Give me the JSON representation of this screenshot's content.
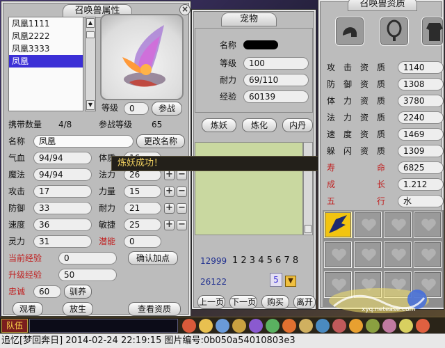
{
  "left_panel": {
    "title": "召唤兽属性",
    "pet_list": [
      "凤凰1111",
      "凤凰2222",
      "凤凰3333",
      "凤凰"
    ],
    "selected_index": 3,
    "level_label": "等级",
    "level_value": "0",
    "battle_button": "参战",
    "carry_label": "携带数量",
    "carry_value": "4/8",
    "battle_level_label": "参战等级",
    "battle_level_value": "65",
    "name_label": "名称",
    "name_value": "凤凰",
    "rename_button": "更改名称",
    "stats_left": [
      {
        "label": "气血",
        "value": "94/94"
      },
      {
        "label": "魔法",
        "value": "94/94"
      },
      {
        "label": "攻击",
        "value": "17"
      },
      {
        "label": "防御",
        "value": "33"
      },
      {
        "label": "速度",
        "value": "36"
      },
      {
        "label": "灵力",
        "value": "31"
      }
    ],
    "stats_right": [
      {
        "label": "体质",
        "value": "16"
      },
      {
        "label": "法力",
        "value": "26"
      },
      {
        "label": "力量",
        "value": "15"
      },
      {
        "label": "耐力",
        "value": "21"
      },
      {
        "label": "敏捷",
        "value": "25"
      },
      {
        "label": "潜能",
        "value": "0"
      }
    ],
    "cur_exp_label": "当前经验",
    "cur_exp_value": "0",
    "up_exp_label": "升级经验",
    "up_exp_value": "50",
    "loyalty_label": "忠诚",
    "loyalty_value": "60",
    "tame_button": "驯养",
    "confirm_button": "确认加点",
    "view_button": "观看",
    "release_button": "放生",
    "aptitude_button": "查看资质"
  },
  "middle_panel": {
    "title": "宠物",
    "name_label": "名称",
    "level_label": "等级",
    "level_value": "100",
    "stamina_label": "耐力",
    "stamina_value": "69/110",
    "exp_label": "经验",
    "exp_value": "60139",
    "tabs": [
      "炼妖",
      "炼化",
      "内丹"
    ],
    "num1": "12999",
    "digits": "1 2 3 4 5 6 7 8",
    "num2": "26122",
    "page_value": "5",
    "prev_button": "上一页",
    "next_button": "下一页",
    "buy_button": "购买",
    "leave_button": "离开"
  },
  "toast": "炼妖成功！",
  "right_panel": {
    "title": "召唤兽资质",
    "aptitudes": [
      {
        "label": "攻击资质",
        "value": "1140"
      },
      {
        "label": "防御资质",
        "value": "1308"
      },
      {
        "label": "体力资质",
        "value": "3780"
      },
      {
        "label": "法力资质",
        "value": "2240"
      },
      {
        "label": "速度资质",
        "value": "1469"
      },
      {
        "label": "躲闪资质",
        "value": "1309"
      }
    ],
    "extra": [
      {
        "label": "寿命",
        "value": "6825"
      },
      {
        "label": "成长",
        "value": "1.212"
      },
      {
        "label": "五行",
        "value": "水"
      }
    ],
    "equip_icons": [
      "helmet-icon",
      "necklace-icon",
      "armor-icon"
    ]
  },
  "chat": {
    "channel": "队伍"
  },
  "status_bar": "追忆[梦回奔日] 2014-02-24 22:19:15 图片编号:0b050a54010803e3",
  "watermark": "xyq.netease.com",
  "colors": {
    "panel": "#bcbcbc",
    "highlight": "#3b2fd6",
    "accent_red": "#c02020",
    "toast_bg": "#23201a"
  }
}
